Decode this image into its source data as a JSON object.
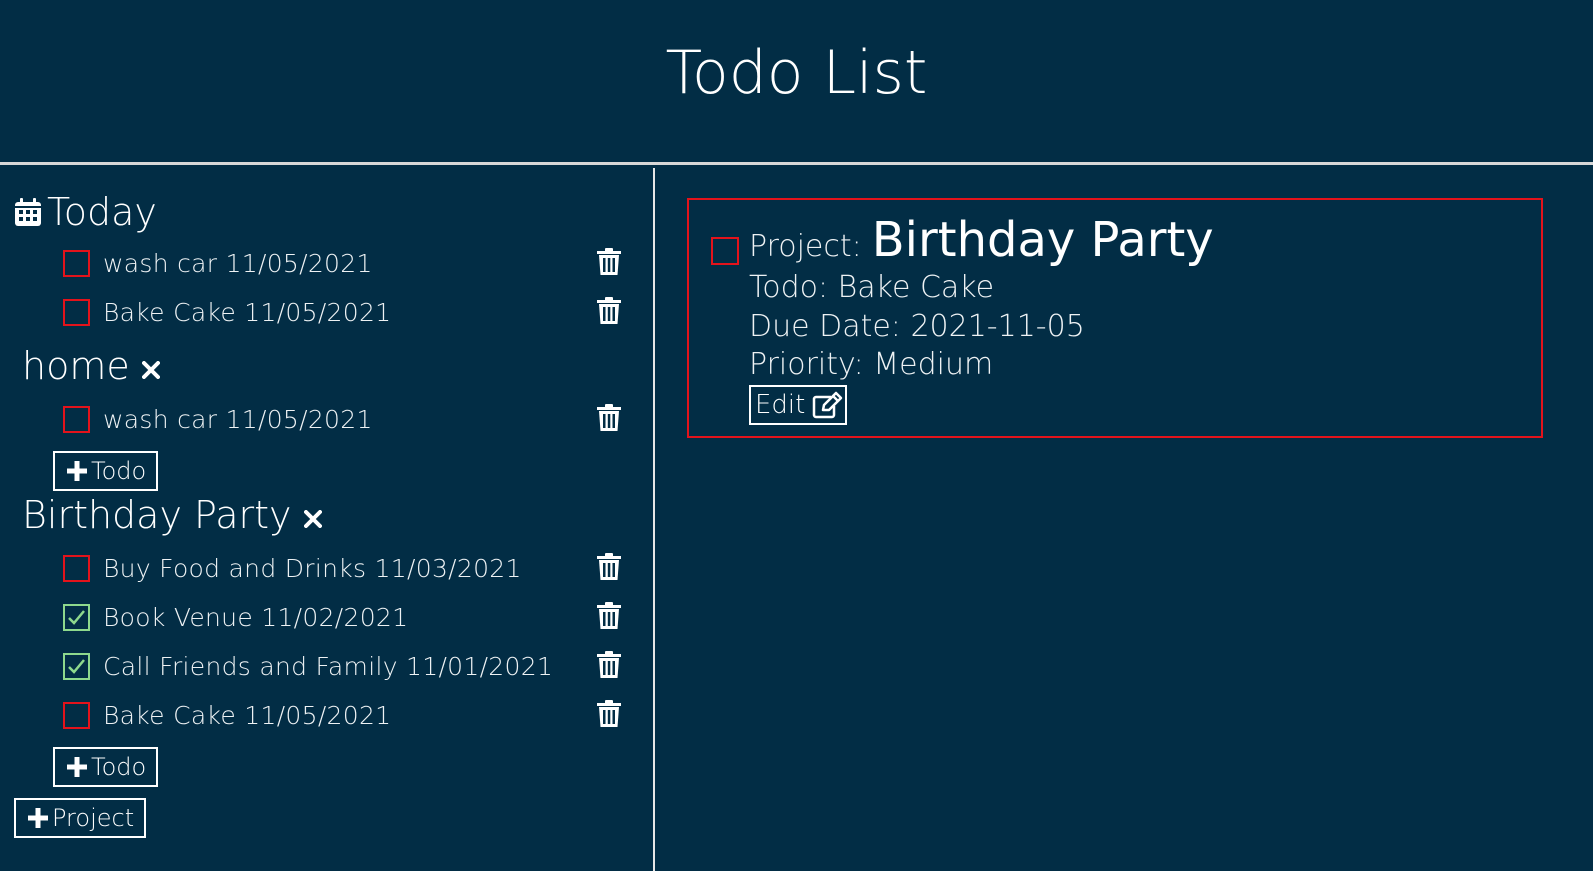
{
  "app": {
    "title": "Todo List"
  },
  "colors": {
    "background": "#022d45",
    "text": "#ffffff",
    "unchecked_border": "#e3131b",
    "checked_border": "#8ed98d",
    "divider": "#d7d7d7"
  },
  "sidebar": {
    "today": {
      "label": "Today",
      "icon": "calendar-icon",
      "todos": [
        {
          "text": "wash car 11/05/2021",
          "done": false
        },
        {
          "text": "Bake Cake 11/05/2021",
          "done": false
        }
      ]
    },
    "projects": [
      {
        "name": "home",
        "todos": [
          {
            "text": "wash car 11/05/2021",
            "done": false
          }
        ],
        "add_todo_label": "Todo"
      },
      {
        "name": "Birthday Party",
        "todos": [
          {
            "text": "Buy Food and Drinks 11/03/2021",
            "done": false
          },
          {
            "text": "Book Venue 11/02/2021",
            "done": true
          },
          {
            "text": "Call Friends and Family 11/01/2021",
            "done": true
          },
          {
            "text": "Bake Cake 11/05/2021",
            "done": false
          }
        ],
        "add_todo_label": "Todo"
      }
    ],
    "add_project_label": "Project"
  },
  "detail": {
    "project_prefix": "Project:",
    "project_name": "Birthday Party",
    "todo_line": "Todo: Bake Cake",
    "due_line": "Due Date: 2021-11-05",
    "priority_line": "Priority: Medium",
    "edit_label": "Edit",
    "done": false
  }
}
